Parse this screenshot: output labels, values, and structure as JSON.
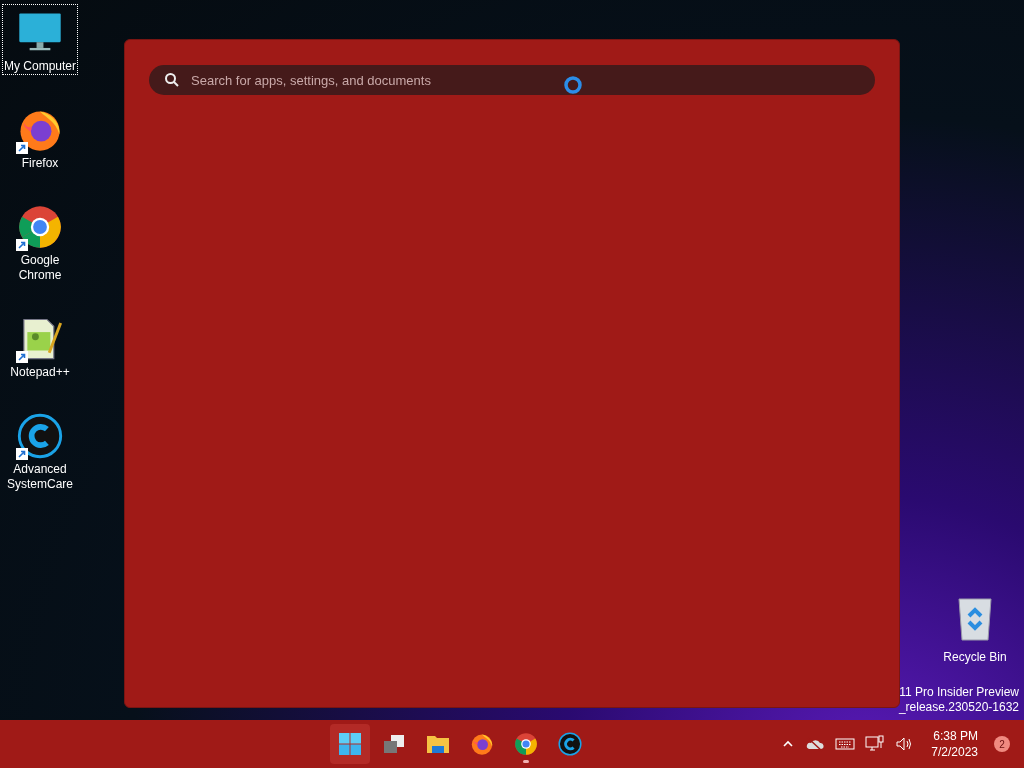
{
  "desktop_icons": [
    {
      "kind": "computer",
      "label": "My Computer",
      "selected": true
    },
    {
      "kind": "firefox",
      "label": "Firefox",
      "selected": false
    },
    {
      "kind": "chrome",
      "label": "Google Chrome",
      "selected": false
    },
    {
      "kind": "notepad",
      "label": "Notepad++",
      "selected": false
    },
    {
      "kind": "care",
      "label": "Advanced SystemCare",
      "selected": false
    }
  ],
  "recycle_bin": {
    "label": "Recycle Bin"
  },
  "watermark_lines": [
    "11 Pro Insider Preview",
    "_release.230520-1632"
  ],
  "start_panel": {
    "search": {
      "placeholder": "Search for apps, settings, and documents"
    }
  },
  "taskbar": {
    "apps": [
      {
        "kind": "start",
        "selected": true,
        "running": false
      },
      {
        "kind": "taskview",
        "selected": false,
        "running": false
      },
      {
        "kind": "explorer",
        "selected": false,
        "running": false
      },
      {
        "kind": "firefox",
        "selected": false,
        "running": false
      },
      {
        "kind": "chrome",
        "selected": false,
        "running": true
      },
      {
        "kind": "care",
        "selected": false,
        "running": false
      }
    ],
    "time": "6:38 PM",
    "date": "7/2/2023",
    "notifications": "2"
  }
}
